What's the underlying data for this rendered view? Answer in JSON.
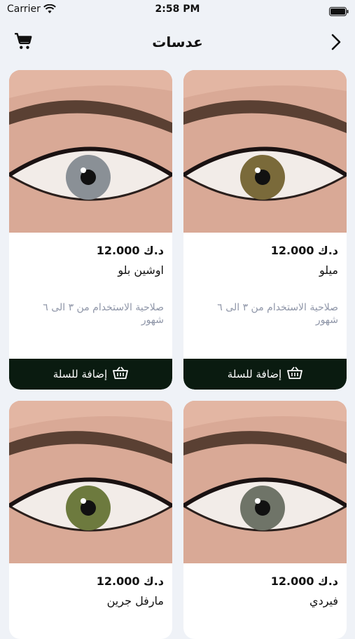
{
  "status": {
    "carrier": "Carrier",
    "time": "2:58 PM"
  },
  "nav": {
    "title": "عدسات"
  },
  "products": [
    {
      "name": "ميلو",
      "price": "د.ك 12.000",
      "desc": "صلاحية الاستخدام من ٣ الى ٦ شهور",
      "button": "إضافة للسلة",
      "iris_color": "#7a6a3a"
    },
    {
      "name": "اوشين بلو",
      "price": "د.ك 12.000",
      "desc": "صلاحية الاستخدام من ٣ الى ٦ شهور",
      "button": "إضافة للسلة",
      "iris_color": "#8a9096"
    },
    {
      "name": "فيردي",
      "price": "د.ك 12.000",
      "iris_color": "#6f7468"
    },
    {
      "name": "مارفل جرين",
      "price": "د.ك 12.000",
      "iris_color": "#6d7a3e"
    }
  ]
}
